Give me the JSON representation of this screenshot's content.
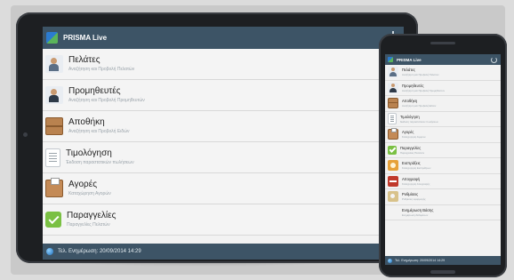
{
  "tablet": {
    "app_title": "PRISMA Live",
    "items": [
      {
        "label": "Πελάτες",
        "sub": "Αναζήτηση και Προβολή Πελατών",
        "icon": "customers-icon"
      },
      {
        "label": "Προμηθευτές",
        "sub": "Αναζήτηση και Προβολή Προμηθευτών",
        "icon": "suppliers-icon"
      },
      {
        "label": "Αποθήκη",
        "sub": "Αναζήτηση και Προβολή Ειδών",
        "icon": "warehouse-box-icon"
      },
      {
        "label": "Τιμολόγηση",
        "sub": "Έκδοση παραστατικών πωλήσεων",
        "icon": "invoice-icon"
      },
      {
        "label": "Αγορές",
        "sub": "Καταχώρηση Αγορών",
        "icon": "purchases-icon"
      },
      {
        "label": "Παραγγελίες",
        "sub": "Παραγγελίες Πελατών",
        "icon": "orders-icon"
      }
    ],
    "status": "Τελ. Ενημέρωση: 20/09/2014 14:29"
  },
  "phone": {
    "app_title": "PRISMA Live",
    "items": [
      {
        "label": "Πελάτες",
        "sub": "Αναζήτηση και Προβολή Πελατών",
        "icon": "customers-icon"
      },
      {
        "label": "Προμηθευτές",
        "sub": "Αναζήτηση και Προβολή Προμηθευτών",
        "icon": "suppliers-icon"
      },
      {
        "label": "Αποθήκη",
        "sub": "Αναζήτηση και Προβολή Ειδών",
        "icon": "warehouse-box-icon"
      },
      {
        "label": "Τιμολόγηση",
        "sub": "Έκδοση παραστατικών πωλήσεων",
        "icon": "invoice-icon"
      },
      {
        "label": "Αγορές",
        "sub": "Καταχώρηση Αγορών",
        "icon": "purchases-icon"
      },
      {
        "label": "Παραγγελίες",
        "sub": "Παραγγελίες Πελατών",
        "icon": "orders-icon"
      },
      {
        "label": "Εισπράξεις",
        "sub": "Καταχώρηση Εισπράξεων",
        "icon": "receipts-icon"
      },
      {
        "label": "Απογραφή",
        "sub": "Καταχώρηση Απογραφής",
        "icon": "inventory-icon"
      },
      {
        "label": "Ρυθμίσεις",
        "sub": "Ρυθμίσεις εφαρμογής",
        "icon": "settings-icon"
      },
      {
        "label": "Ενημέρωση Βάσης",
        "sub": "Ενημέρωση δεδομένων",
        "icon": "sync-icon"
      }
    ],
    "status": "Τελ. Ενημέρωση: 20/09/2014 14:29"
  },
  "colors": {
    "appbar": "#3d5466",
    "list_bg": "#f4f4f4",
    "device_frame": "#1d1f22"
  }
}
